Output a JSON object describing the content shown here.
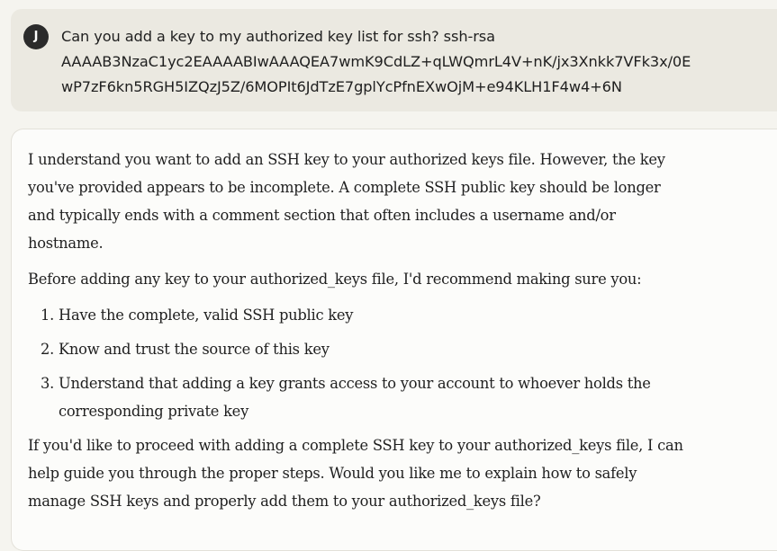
{
  "user_message": {
    "avatar_initial": "J",
    "lines": [
      "Can you add a key to my authorized key list for ssh?  ssh-rsa",
      "AAAAB3NzaC1yc2EAAAABIwAAAQEA7wmK9CdLZ+qLWQmrL4V+nK/jx3Xnkk7VFk3x/0E",
      "wP7zF6kn5RGH5IZQzJ5Z/6MOPIt6JdTzE7gplYcPfnEXwOjM+e94KLH1F4w4+6N"
    ]
  },
  "assistant_message": {
    "intro_lines": [
      "I understand you want to add an SSH key to your authorized keys file. However, the key",
      "you've provided appears to be incomplete. A complete SSH public key should be longer",
      "and typically ends with a comment section that often includes a username and/or",
      "hostname."
    ],
    "recommend": "Before adding any key to your authorized_keys file, I'd recommend making sure you:",
    "steps": [
      {
        "number": "1.",
        "lines": [
          "Have the complete, valid SSH public key"
        ]
      },
      {
        "number": "2.",
        "lines": [
          "Know and trust the source of this key"
        ]
      },
      {
        "number": "3.",
        "lines": [
          "Understand that adding a key grants access to your account to whoever holds the",
          "corresponding private key"
        ]
      }
    ],
    "closing_lines": [
      "If you'd like to proceed with adding a complete SSH key to your authorized_keys file, I can",
      "help guide you through the proper steps. Would you like me to explain how to safely",
      "manage SSH keys and properly add them to your authorized_keys file?"
    ]
  }
}
